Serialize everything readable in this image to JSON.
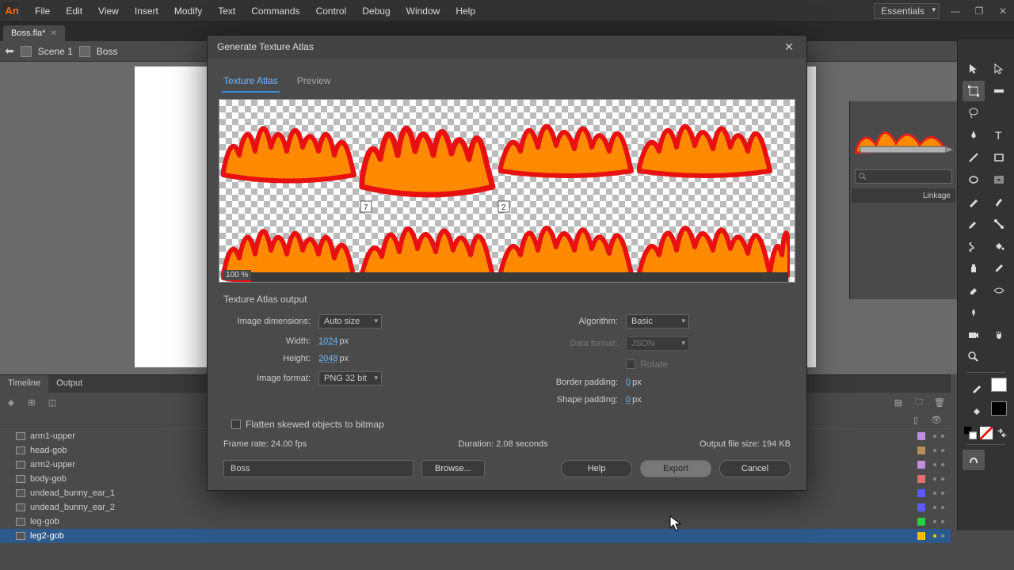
{
  "app": {
    "logo_letter": "An"
  },
  "menu": [
    "File",
    "Edit",
    "View",
    "Insert",
    "Modify",
    "Text",
    "Commands",
    "Control",
    "Debug",
    "Window",
    "Help"
  ],
  "workspace": "Essentials",
  "file_tab": "Boss.fla*",
  "scene": {
    "name": "Scene 1",
    "symbol": "Boss"
  },
  "right_panel": {
    "linkage_label": "Linkage"
  },
  "timeline": {
    "tabs": [
      "Timeline",
      "Output"
    ],
    "active_tab": 0,
    "layers": [
      {
        "name": "arm1-upper",
        "color": "#c08fe0"
      },
      {
        "name": "head-gob",
        "color": "#b48f5a"
      },
      {
        "name": "arm2-upper",
        "color": "#c08fe0"
      },
      {
        "name": "body-gob",
        "color": "#e06f6f"
      },
      {
        "name": "undead_bunny_ear_1",
        "color": "#5a5aff"
      },
      {
        "name": "undead_bunny_ear_2",
        "color": "#5a5aff"
      },
      {
        "name": "leg-gob",
        "color": "#2ecc40"
      },
      {
        "name": "leg2-gob",
        "color": "#ffbf00",
        "selected": true
      }
    ]
  },
  "modal": {
    "title": "Generate Texture Atlas",
    "tabs": [
      "Texture Atlas",
      "Preview"
    ],
    "active_tab": 0,
    "zoom": "100 %",
    "output_section": "Texture Atlas output",
    "labels": {
      "image_dimensions": "Image dimensions:",
      "width": "Width:",
      "height": "Height:",
      "image_format": "Image format:",
      "algorithm": "Algorithm:",
      "data_format": "Data format:",
      "rotate": "Rotate",
      "border_padding": "Border padding:",
      "shape_padding": "Shape padding:",
      "flatten": "Flatten skewed objects to bitmap"
    },
    "values": {
      "image_dimensions": "Auto size",
      "width": "1024",
      "height": "2048",
      "px": "px",
      "image_format": "PNG 32 bit",
      "algorithm": "Basic",
      "data_format": "JSON",
      "border_padding": "0",
      "shape_padding": "0"
    },
    "info": {
      "frame_rate": "Frame rate: 24.00 fps",
      "duration": "Duration: 2.08 seconds",
      "output_size": "Output file size: 194 KB"
    },
    "path": "Boss",
    "buttons": {
      "browse": "Browse...",
      "help": "Help",
      "export": "Export",
      "cancel": "Cancel"
    }
  },
  "tools": [
    "selection",
    "subselection",
    "free-transform",
    "lasso",
    "pen",
    "text",
    "line",
    "rectangle",
    "pencil",
    "brush",
    "bone",
    "bind",
    "bucket",
    "ink",
    "eyedropper",
    "eraser",
    "camera",
    "hand",
    "zoom"
  ]
}
